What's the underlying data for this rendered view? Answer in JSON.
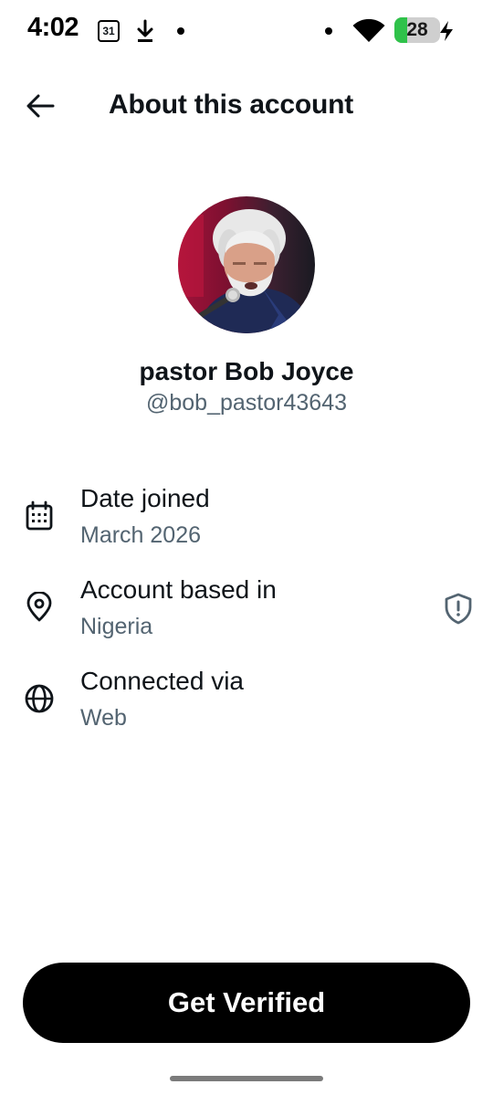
{
  "status_bar": {
    "time": "4:02",
    "calendar_day": "31",
    "battery_level": "28",
    "battery_fraction": 0.28,
    "icons": [
      "calendar-icon",
      "download-icon",
      "notification-dot",
      "wifi-icon",
      "battery-icon",
      "charging-bolt-icon"
    ]
  },
  "header": {
    "title": "About this account",
    "back_icon": "arrow-left-icon"
  },
  "profile": {
    "display_name": "pastor Bob Joyce",
    "handle": "@bob_pastor43643"
  },
  "info": [
    {
      "label": "Date joined",
      "value": "March 2026",
      "icon": "calendar-icon"
    },
    {
      "label": "Account based in",
      "value": "Nigeria",
      "icon": "location-pin-icon",
      "extra_icon": "shield-alert-icon"
    },
    {
      "label": "Connected via",
      "value": "Web",
      "icon": "globe-icon"
    }
  ],
  "cta": {
    "label": "Get Verified"
  },
  "colors": {
    "text_primary": "#0f1419",
    "text_secondary": "#536471",
    "cta_background": "#000000",
    "battery_green": "#2fc24a"
  }
}
